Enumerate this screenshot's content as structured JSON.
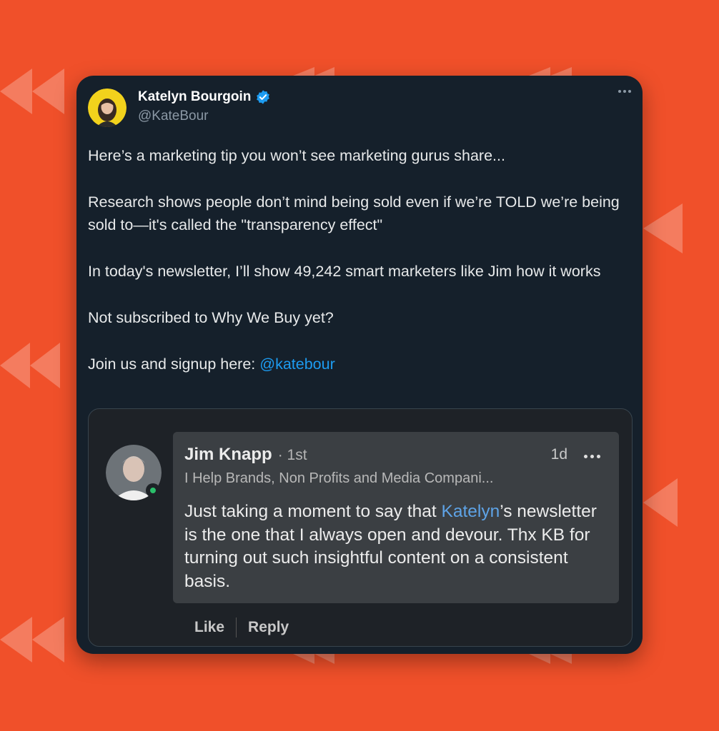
{
  "tweet": {
    "author_name": "Katelyn Bourgoin",
    "handle": "@KateBour",
    "paragraphs": [
      "Here’s a marketing tip you won’t see marketing gurus share...",
      "Research shows people don’t mind being sold even if we’re TOLD we’re being sold to—it's called the \"transparency effect\"",
      "In today's newsletter, I’ll show 49,242 smart marketers like Jim how it works",
      "Not subscribed to Why We Buy yet?"
    ],
    "cta_prefix": "Join us and signup here: ",
    "cta_mention": "@katebour"
  },
  "quoted_comment": {
    "name": "Jim Knapp",
    "degree": "· 1st",
    "time": "1d",
    "headline": "I Help Brands, Non Profits and Media Compani...",
    "text_before": "Just taking a moment to say that ",
    "text_link": "Katelyn",
    "text_after": "’s newsletter is the one that I always open and devour. Thx KB for turning out such insightful content on a consistent basis.",
    "like_label": "Like",
    "reply_label": "Reply"
  },
  "colors": {
    "background": "#f0502a",
    "card": "#15202b",
    "accent": "#1d9bf0",
    "online": "#2bbf6a"
  }
}
